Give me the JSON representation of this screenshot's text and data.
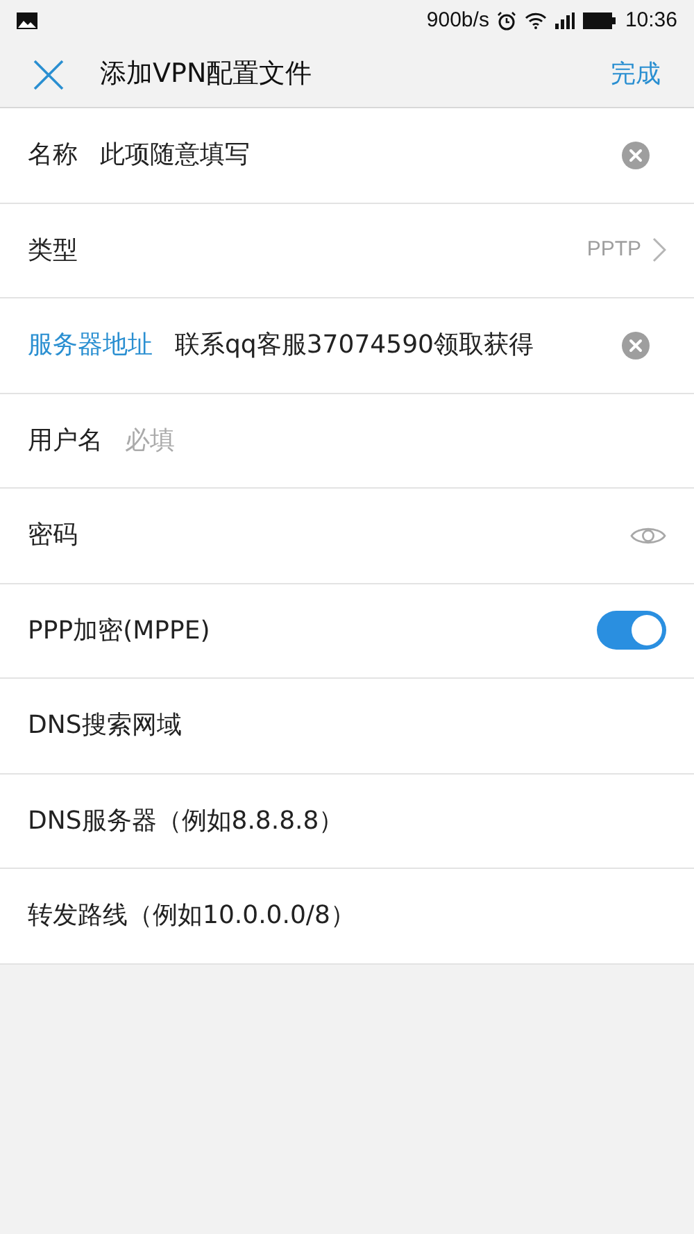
{
  "status_bar": {
    "speed": "900b/s",
    "time": "10:36"
  },
  "header": {
    "title": "添加VPN配置文件",
    "done": "完成"
  },
  "fields": [
    {
      "kind": "text",
      "label": "名称",
      "value": "此项随意填写",
      "focused": false
    },
    {
      "kind": "select",
      "label": "类型",
      "value": "PPTP"
    },
    {
      "kind": "text",
      "label": "服务器地址",
      "value": "联系qq客服37074590领取获得",
      "focused": true
    },
    {
      "kind": "text",
      "label": "用户名",
      "placeholder": "必填",
      "focused": false
    },
    {
      "kind": "password",
      "label": "密码"
    },
    {
      "kind": "switch",
      "label": "PPP加密(MPPE)",
      "on": true
    },
    {
      "kind": "text",
      "label": "DNS搜索网域",
      "focused": false
    },
    {
      "kind": "text",
      "label": "DNS服务器（例如8.8.8.8）",
      "focused": false
    },
    {
      "kind": "text",
      "label": "转发路线（例如10.0.0.0/8）",
      "focused": false
    }
  ]
}
